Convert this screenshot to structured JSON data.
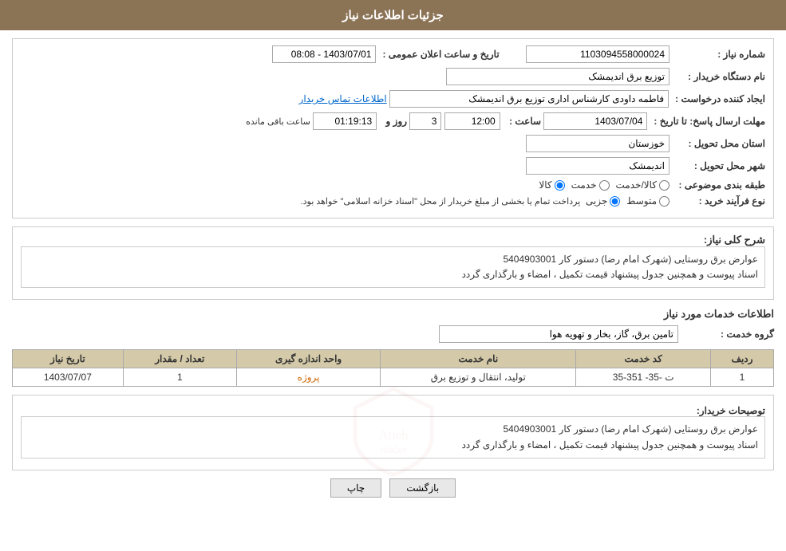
{
  "header": {
    "title": "جزئیات اطلاعات نیاز"
  },
  "fields": {
    "id_label": "شماره نیاز :",
    "id_value": "1103094558000024",
    "buyer_label": "نام دستگاه خریدار :",
    "buyer_value": "توزیع برق اندیمشک",
    "creator_label": "ایجاد کننده درخواست :",
    "creator_value": "فاطمه داودی کارشناس اداری توزیع برق اندیمشک",
    "contact_link": "اطلاعات تماس خریدار",
    "deadline_label": "مهلت ارسال پاسخ: تا تاریخ :",
    "deadline_date": "1403/07/04",
    "deadline_time_label": "ساعت :",
    "deadline_time": "12:00",
    "deadline_days_label": "روز و",
    "deadline_days": "3",
    "remaining_label": "ساعت باقی مانده",
    "remaining_time": "01:19:13",
    "province_label": "استان محل تحویل :",
    "province_value": "خوزستان",
    "city_label": "شهر محل تحویل :",
    "city_value": "اندیمشک",
    "datetime_label": "تاریخ و ساعت اعلان عمومی :",
    "datetime_value": "1403/07/01 - 08:08",
    "category_label": "طبقه بندی موضوعی :",
    "category_options": [
      "کالا",
      "خدمت",
      "کالا/خدمت"
    ],
    "category_selected": "کالا",
    "purchase_type_label": "نوع فرآیند خرید :",
    "purchase_options": [
      "جزیی",
      "متوسط"
    ],
    "purchase_note": "پرداخت تمام یا بخشی از مبلغ خریدار از محل \"اسناد خزانه اسلامی\" خواهد بود.",
    "description_section_title": "شرح کلی نیاز:",
    "description_value": "عوارض برق روستایی (شهرک امام رضا)   دستور کار 5404903001\nاسناد پیوست و همچنین جدول پیشنهاد قیمت تکمیل ، امضاء  و بارگذاری گردد",
    "services_section_title": "اطلاعات خدمات مورد نیاز",
    "service_group_label": "گروه خدمت :",
    "service_group_value": "تامین برق، گاز، بخار و تهویه هوا",
    "table": {
      "headers": [
        "ردیف",
        "کد خدمت",
        "نام خدمت",
        "واحد اندازه گیری",
        "تعداد / مقدار",
        "تاریخ نیاز"
      ],
      "rows": [
        {
          "row": "1",
          "code": "ت -35- 351-35",
          "name": "تولید، انتقال و توزیع برق",
          "unit": "پروژه",
          "quantity": "1",
          "date": "1403/07/07"
        }
      ]
    },
    "buyer_description_label": "توصیحات خریدار:",
    "buyer_description_value": "عوارض برق روستایی (شهرک امام رضا)   دستور کار 5404903001\nاسناد پیوست و همچنین جدول پیشنهاد قیمت تکمیل ، امضاء  و بارگذاری گردد"
  },
  "buttons": {
    "print": "چاپ",
    "back": "بازگشت"
  }
}
